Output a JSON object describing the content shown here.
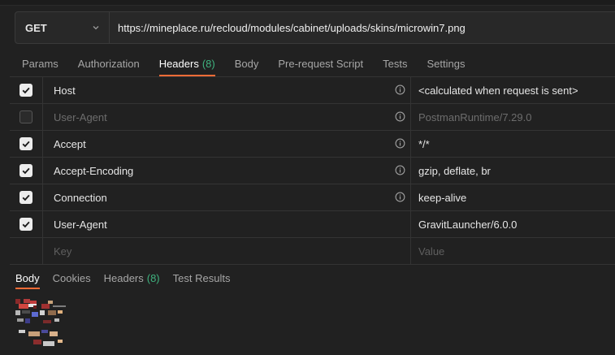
{
  "request": {
    "method": "GET",
    "url": "https://mineplace.ru/recloud/modules/cabinet/uploads/skins/microwin7.png"
  },
  "request_tabs": [
    {
      "label": "Params"
    },
    {
      "label": "Authorization"
    },
    {
      "label": "Headers",
      "count": "(8)"
    },
    {
      "label": "Body"
    },
    {
      "label": "Pre-request Script"
    },
    {
      "label": "Tests"
    },
    {
      "label": "Settings"
    }
  ],
  "headers": [
    {
      "enabled": true,
      "key": "Host",
      "info": true,
      "value": "<calculated when request is sent>"
    },
    {
      "enabled": false,
      "key": "User-Agent",
      "info": true,
      "value": "PostmanRuntime/7.29.0"
    },
    {
      "enabled": true,
      "key": "Accept",
      "info": true,
      "value": "*/*"
    },
    {
      "enabled": true,
      "key": "Accept-Encoding",
      "info": true,
      "value": "gzip, deflate, br"
    },
    {
      "enabled": true,
      "key": "Connection",
      "info": true,
      "value": "keep-alive"
    },
    {
      "enabled": true,
      "key": "User-Agent",
      "info": false,
      "value": "GravitLauncher/6.0.0"
    }
  ],
  "new_header": {
    "key_placeholder": "Key",
    "value_placeholder": "Value"
  },
  "response_tabs": [
    {
      "label": "Body"
    },
    {
      "label": "Cookies"
    },
    {
      "label": "Headers",
      "count": "(8)"
    },
    {
      "label": "Test Results"
    }
  ],
  "colors": {
    "accent": "#ff6c37",
    "count": "#3fb37f",
    "background": "#212121"
  }
}
